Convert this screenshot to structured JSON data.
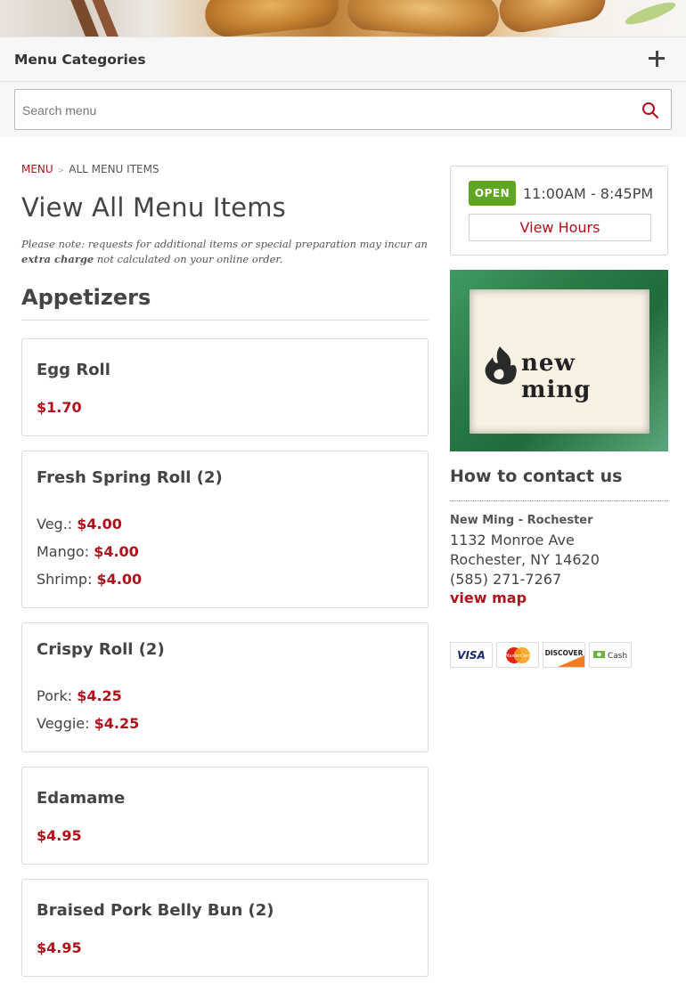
{
  "categories_bar": {
    "title": "Menu Categories",
    "toggle_icon": "plus-icon"
  },
  "search": {
    "placeholder": "Search menu",
    "icon": "search-icon"
  },
  "breadcrumb": {
    "home": "MENU",
    "current": "ALL MENU ITEMS"
  },
  "page": {
    "title": "View All Menu Items",
    "note_prefix": "Please note: requests for additional items or special preparation may incur an ",
    "note_bold": "extra charge",
    "note_suffix": " not calculated on your online order."
  },
  "section": {
    "title": "Appetizers"
  },
  "items": [
    {
      "name": "Egg Roll",
      "price": "$1.70"
    },
    {
      "name": "Fresh Spring Roll (2)",
      "options": [
        {
          "label": "Veg.:",
          "price": "$4.00"
        },
        {
          "label": "Mango:",
          "price": "$4.00"
        },
        {
          "label": "Shrimp:",
          "price": "$4.00"
        }
      ]
    },
    {
      "name": "Crispy Roll (2)",
      "options": [
        {
          "label": "Pork:",
          "price": "$4.25"
        },
        {
          "label": "Veggie:",
          "price": "$4.25"
        }
      ]
    },
    {
      "name": "Edamame",
      "price": "$4.95"
    },
    {
      "name": "Braised Pork Belly Bun (2)",
      "price": "$4.95"
    }
  ],
  "hours": {
    "status": "OPEN",
    "range": "11:00AM - 8:45PM",
    "button": "View Hours"
  },
  "logo": {
    "text": "new ming"
  },
  "contact": {
    "title": "How to contact us",
    "name": "New Ming - Rochester",
    "street": "1132 Monroe Ave",
    "city": "Rochester, NY 14620",
    "phone": "(585) 271-7267",
    "map_link": "view map"
  },
  "payments": [
    {
      "label": "VISA",
      "icon": "visa-icon"
    },
    {
      "label": "MasterCard",
      "icon": "mastercard-icon"
    },
    {
      "label": "DISCOVER",
      "icon": "discover-icon"
    },
    {
      "label": "Cash",
      "icon": "cash-icon"
    }
  ],
  "colors": {
    "accent": "#b0121b",
    "open": "#5ea61f",
    "logo_frame": "#2a7a48"
  }
}
